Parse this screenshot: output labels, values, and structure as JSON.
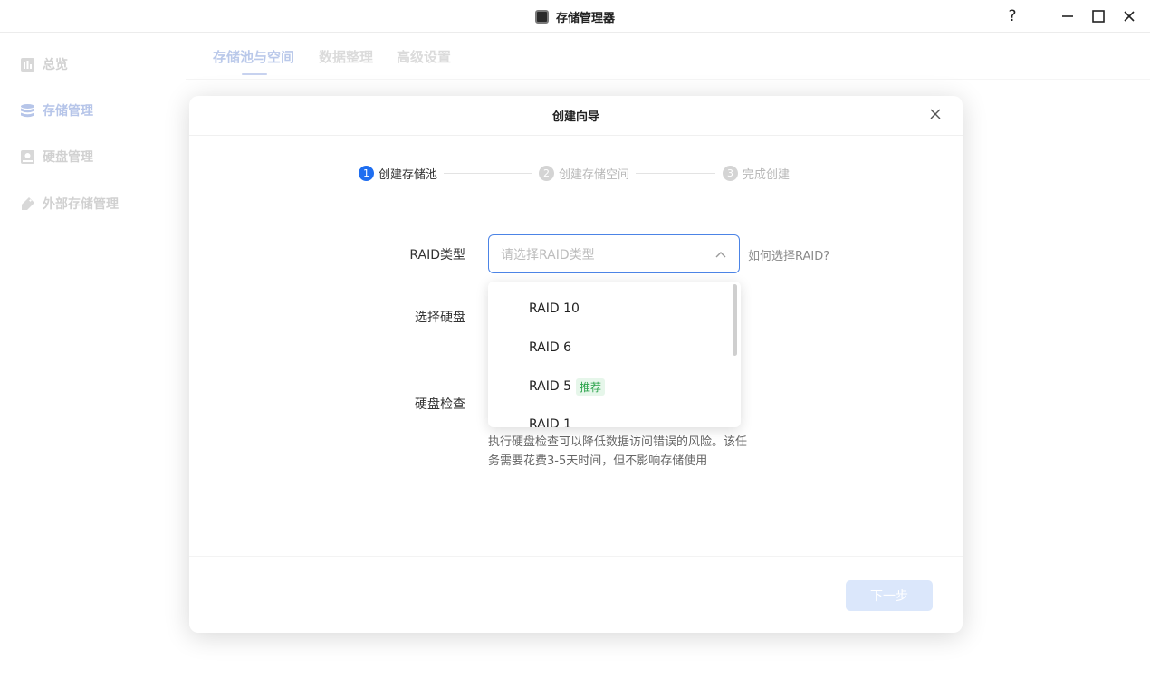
{
  "window": {
    "title": "存储管理器",
    "help_label": "?",
    "minimize_label": "—",
    "maximize_label": "☐",
    "close_label": "✕"
  },
  "sidebar": {
    "items": [
      {
        "label": "总览",
        "icon": "chart-icon"
      },
      {
        "label": "存储管理",
        "icon": "database-icon",
        "active": true
      },
      {
        "label": "硬盘管理",
        "icon": "disk-icon"
      },
      {
        "label": "外部存储管理",
        "icon": "usb-icon"
      }
    ]
  },
  "tabs": [
    {
      "label": "存储池与空间",
      "active": true
    },
    {
      "label": "数据整理"
    },
    {
      "label": "高级设置"
    }
  ],
  "modal": {
    "title": "创建向导",
    "steps": [
      {
        "num": "1",
        "label": "创建存储池",
        "active": true
      },
      {
        "num": "2",
        "label": "创建存储空间"
      },
      {
        "num": "3",
        "label": "完成创建"
      }
    ],
    "form": {
      "raid_label": "RAID类型",
      "raid_placeholder": "请选择RAID类型",
      "raid_help": "如何选择RAID?",
      "disk_label": "选择硬盘",
      "check_label": "硬盘检查",
      "check_hint": "执行硬盘检查可以降低数据访问错误的风险。该任务需要花费3-5天时间，但不影响存储使用"
    },
    "next_label": "下一步"
  },
  "dropdown": {
    "options": [
      {
        "label": "RAID 10"
      },
      {
        "label": "RAID 6"
      },
      {
        "label": "RAID 5",
        "badge": "推荐"
      },
      {
        "label": "RAID 1"
      }
    ]
  },
  "colors": {
    "accent": "#1f6ef0",
    "accent_light": "#96acdf",
    "badge_green": "#2aa34a"
  }
}
